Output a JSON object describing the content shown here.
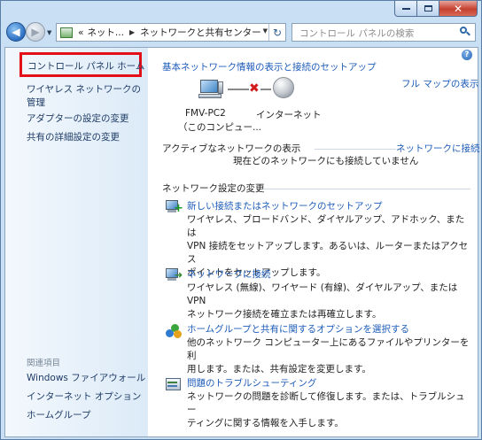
{
  "window": {
    "min_glyph": "minimize",
    "max_glyph": "maximize",
    "close_glyph": "✕"
  },
  "address": {
    "prefix": "«",
    "crumb1": "ネット...",
    "crumb2": "ネットワークと共有センター",
    "search_placeholder": "コントロール パネルの検索"
  },
  "sidebar": {
    "home": "コントロール パネル ホーム",
    "wireless_mgmt": "ワイヤレス ネットワークの管理",
    "adapter": "アダプターの設定の変更",
    "sharing": "共有の詳細設定の変更",
    "related_heading": "関連項目",
    "related": [
      "Windows ファイアウォール",
      "インターネット オプション",
      "ホームグループ"
    ]
  },
  "main": {
    "title": "基本ネットワーク情報の表示と接続のセットアップ",
    "full_map": "フル マップの表示",
    "computer_name": "FMV-PC2",
    "computer_sub": "（このコンピュー...",
    "internet": "インターネット",
    "active_heading": "アクティブなネットワークの表示",
    "connect_link": "ネットワークに接続",
    "not_connected": "現在どのネットワークにも接続していません",
    "change_heading": "ネットワーク設定の変更",
    "tasks": [
      {
        "title": "新しい接続またはネットワークのセットアップ",
        "desc": [
          "ワイヤレス、ブロードバンド、ダイヤルアップ、アドホック、または",
          "VPN 接続をセットアップします。あるいは、ルーターまたはアクセス",
          "ポイントをセットアップします。"
        ]
      },
      {
        "title": "ネットワークに接続",
        "desc": [
          "ワイヤレス (無線)、ワイヤード (有線)、ダイヤルアップ、または VPN",
          "ネットワーク接続を確立または再確立します。"
        ]
      },
      {
        "title": "ホームグループと共有に関するオプションを選択する",
        "desc": [
          "他のネットワーク コンピューター上にあるファイルやプリンターを利",
          "用します。または、共有設定を変更します。"
        ]
      },
      {
        "title": "問題のトラブルシューティング",
        "desc": [
          "ネットワークの問題を診断して修復します。または、トラブルシュー",
          "ティングに関する情報を入手します。"
        ]
      }
    ]
  },
  "colors": {
    "link": "#1c5bb9",
    "highlight": "#e3101a"
  }
}
